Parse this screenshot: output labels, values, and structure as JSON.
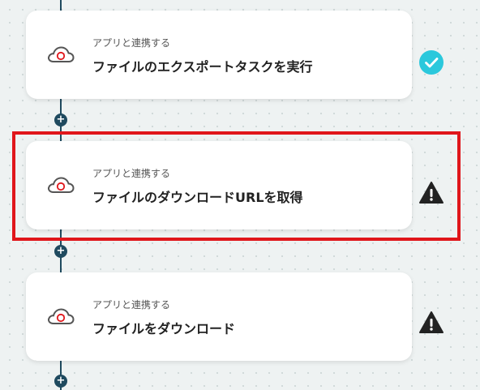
{
  "steps": [
    {
      "subtitle": "アプリと連携する",
      "title": "ファイルのエクスポートタスクを実行",
      "status": "check-circle-icon",
      "status_color": "#2bc8dc"
    },
    {
      "subtitle": "アプリと連携する",
      "title": "ファイルのダウンロードURLを取得",
      "status": "warning-icon",
      "status_color": "#222222"
    },
    {
      "subtitle": "アプリと連携する",
      "title": "ファイルをダウンロード",
      "status": "warning-icon",
      "status_color": "#222222"
    }
  ],
  "colors": {
    "flow_line": "#1f4a5f",
    "highlight": "#e0161b",
    "check": "#2bc8dc"
  },
  "add_button_label": "+"
}
